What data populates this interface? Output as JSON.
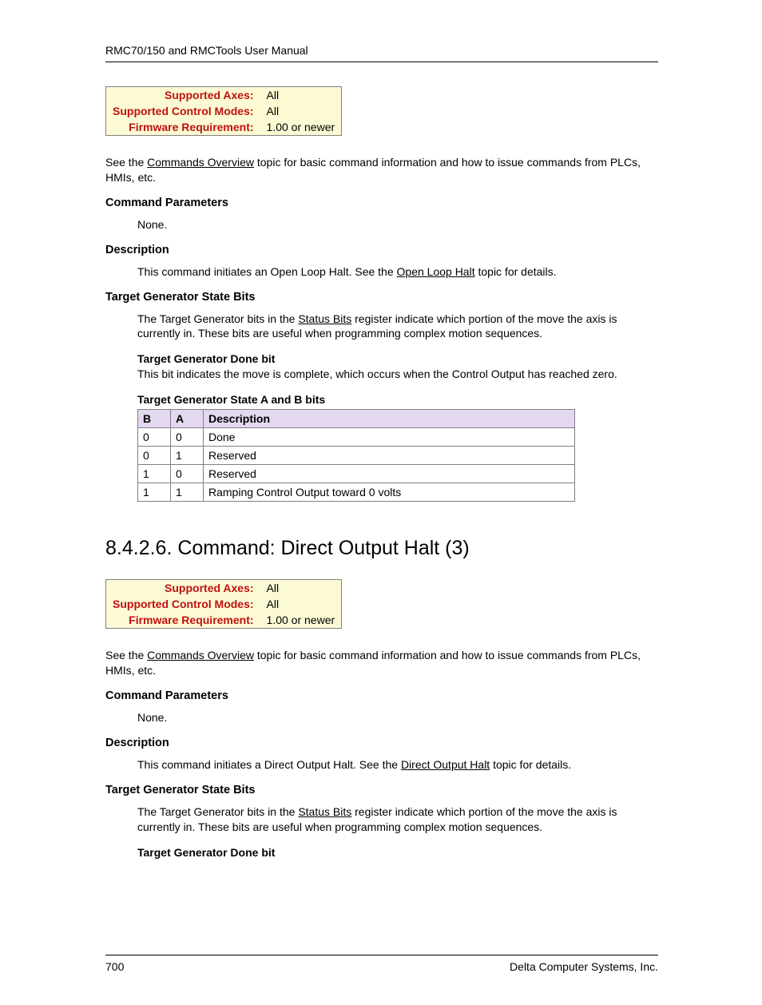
{
  "header": {
    "title": "RMC70/150 and RMCTools User Manual"
  },
  "section1": {
    "info": [
      {
        "label": "Supported Axes:",
        "value": "All"
      },
      {
        "label": "Supported Control Modes:",
        "value": "All"
      },
      {
        "label": "Firmware Requirement:",
        "value": "1.00 or newer"
      }
    ],
    "see_pre": "See the ",
    "see_link": "Commands Overview",
    "see_post": " topic for basic command information and how to issue commands from PLCs, HMIs, etc.",
    "cmd_params_h": "Command Parameters",
    "cmd_params_body": "None.",
    "desc_h": "Description",
    "desc_pre": "This command initiates an Open Loop Halt. See the ",
    "desc_link": "Open Loop Halt",
    "desc_post": " topic for details.",
    "tgsb_h": "Target Generator State Bits",
    "tgsb_pre": "The Target Generator bits in the ",
    "tgsb_link": "Status Bits",
    "tgsb_post": " register indicate which portion of the move the axis is currently in. These bits are useful when programming complex motion sequences.",
    "tgdone_h": "Target Generator Done bit",
    "tgdone_body": "This bit indicates the move is complete, which occurs when the Control Output has reached zero.",
    "tgab_h": "Target Generator State A and B bits",
    "table": {
      "head": {
        "b": "B",
        "a": "A",
        "d": "Description"
      },
      "rows": [
        {
          "b": "0",
          "a": "0",
          "d": "Done"
        },
        {
          "b": "0",
          "a": "1",
          "d": "Reserved"
        },
        {
          "b": "1",
          "a": "0",
          "d": "Reserved"
        },
        {
          "b": "1",
          "a": "1",
          "d": "Ramping Control Output toward 0 volts"
        }
      ]
    }
  },
  "section2": {
    "title": "8.4.2.6. Command: Direct Output Halt (3)",
    "info": [
      {
        "label": "Supported Axes:",
        "value": "All"
      },
      {
        "label": "Supported Control Modes:",
        "value": "All"
      },
      {
        "label": "Firmware Requirement:",
        "value": "1.00 or newer"
      }
    ],
    "see_pre": "See the ",
    "see_link": "Commands Overview",
    "see_post": " topic for basic command information and how to issue commands from PLCs, HMIs, etc.",
    "cmd_params_h": "Command Parameters",
    "cmd_params_body": "None.",
    "desc_h": "Description",
    "desc_pre": "This command initiates a Direct Output Halt. See the ",
    "desc_link": "Direct Output Halt",
    "desc_post": " topic for details.",
    "tgsb_h": "Target Generator State Bits",
    "tgsb_pre": "The Target Generator bits in the ",
    "tgsb_link": "Status Bits",
    "tgsb_post": " register indicate which portion of the move the axis is currently in. These bits are useful when programming complex motion sequences.",
    "tgdone_h": "Target Generator Done bit"
  },
  "footer": {
    "page": "700",
    "company": "Delta Computer Systems, Inc."
  }
}
